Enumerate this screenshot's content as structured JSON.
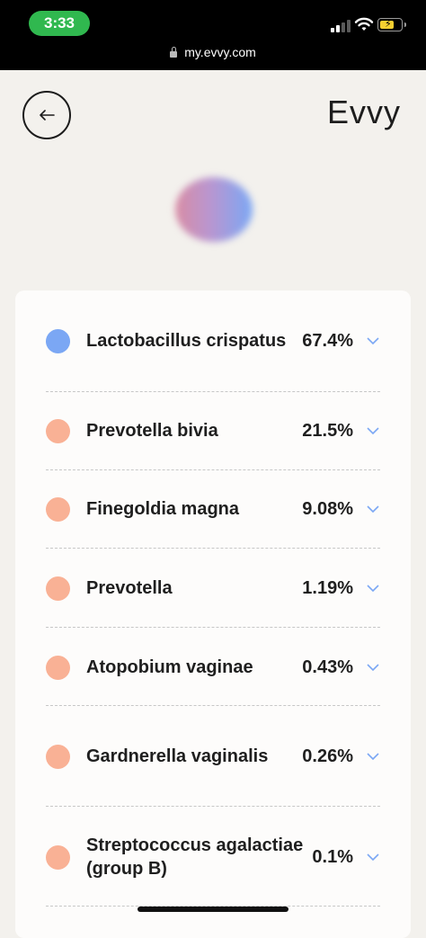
{
  "status": {
    "time": "3:33",
    "url": "my.evvy.com"
  },
  "header": {
    "brand": "Evvy"
  },
  "colors": {
    "blue_dot": "#7ba7f4",
    "peach_dot": "#f9b195",
    "chevron": "#7ba7f4"
  },
  "microbes": [
    {
      "name": "Lactobacillus crispatus",
      "percent": "67.4%",
      "color": "blue"
    },
    {
      "name": "Prevotella bivia",
      "percent": "21.5%",
      "color": "peach"
    },
    {
      "name": "Finegoldia magna",
      "percent": "9.08%",
      "color": "peach"
    },
    {
      "name": "Prevotella",
      "percent": "1.19%",
      "color": "peach"
    },
    {
      "name": "Atopobium vaginae",
      "percent": "0.43%",
      "color": "peach"
    },
    {
      "name": "Gardnerella vaginalis",
      "percent": "0.26%",
      "color": "peach"
    },
    {
      "name": "Streptococcus agalactiae (group B)",
      "percent": "0.1%",
      "color": "peach"
    }
  ]
}
